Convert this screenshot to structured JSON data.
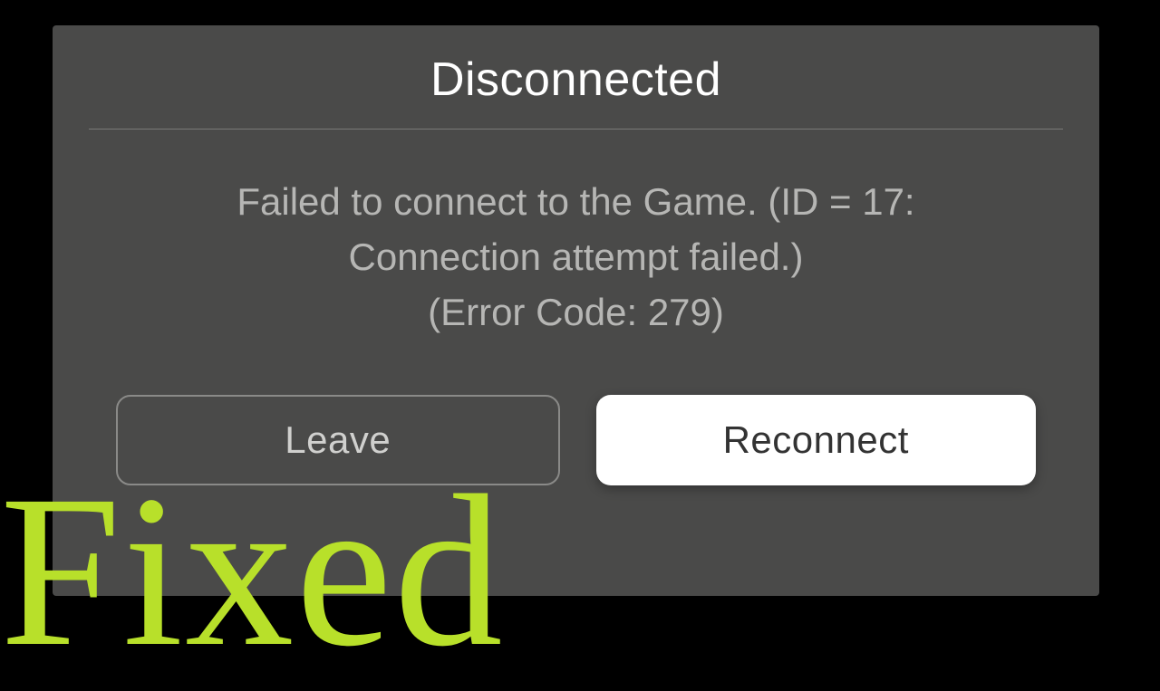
{
  "dialog": {
    "title": "Disconnected",
    "message_line1": "Failed to connect to the Game. (ID = 17:",
    "message_line2": "Connection attempt failed.)",
    "message_line3": "(Error Code: 279)",
    "leave_label": "Leave",
    "reconnect_label": "Reconnect"
  },
  "overlay": {
    "text": "Fixed"
  }
}
